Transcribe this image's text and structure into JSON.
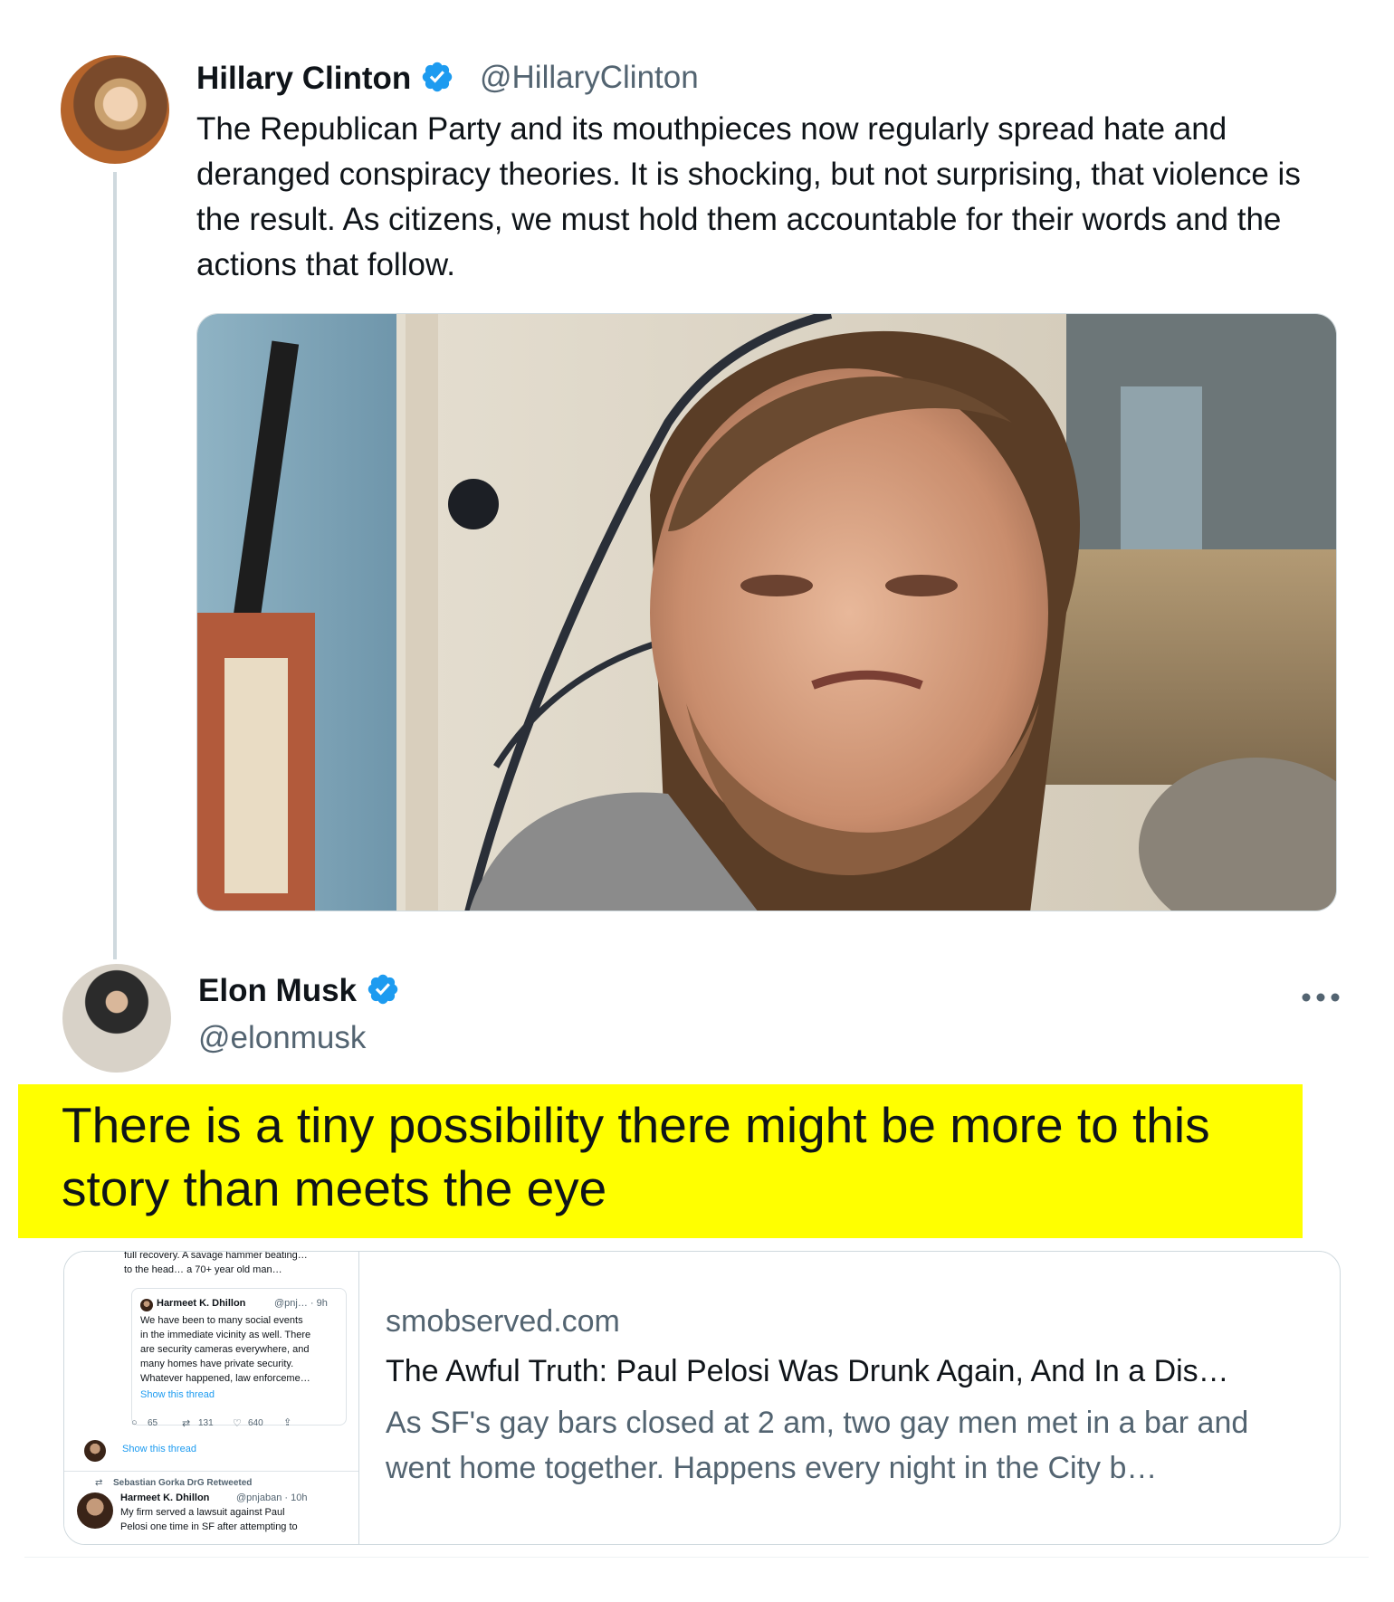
{
  "tweet1": {
    "name": "Hillary Clinton",
    "handle": "@HillaryClinton",
    "text": "The Republican Party and its mouthpieces now regularly spread hate and deranged conspiracy theories. It is shocking, but not surprising, that violence is the result. As citizens, we must hold them accountable for their words and the actions that follow.",
    "avatar_icon": "profile-photo",
    "verified_icon": "verified-badge-icon",
    "media": "photo-man-portrait"
  },
  "tweet2": {
    "name": "Elon Musk",
    "handle": "@elonmusk",
    "text": "There is a tiny possibility there might be more to this story than meets the eye",
    "more_icon": "ellipsis-icon",
    "highlight_color": "#ffff00",
    "card": {
      "domain": "smobserved.com",
      "title": "The Awful Truth: Paul Pelosi Was Drunk Again, And In a Dis…",
      "description": "As SF's gay bars closed at 2 am, two gay men met in a bar and went home together. Happens every night in the City b…",
      "thumb": {
        "top_text_1": "full recovery. A savage hammer beating…",
        "top_text_2": "to the head… a 70+ year old man…",
        "quote_name": "Harmeet K. Dhillon",
        "quote_meta": "@pnj… · 9h",
        "quote_text_1": "We have been to many social events",
        "quote_text_2": "in the immediate vicinity as well. There",
        "quote_text_3": "are security cameras everywhere, and",
        "quote_text_4": "many homes have private security.",
        "quote_text_5": "Whatever happened, law enforceme…",
        "show_thread_1": "Show this thread",
        "reply_count": "65",
        "retweet_count": "131",
        "like_count": "640",
        "show_thread_2": "Show this thread",
        "retweeted_by": "Sebastian Gorka DrG Retweeted",
        "tweet_name": "Harmeet K. Dhillon",
        "tweet_meta": "@pnjaban · 10h",
        "tweet_text_1": "My firm served a lawsuit against Paul",
        "tweet_text_2": "Pelosi one time in SF after attempting to"
      }
    }
  },
  "colors": {
    "link_blue": "#1d9bf0",
    "secondary_text": "#536471",
    "primary_text": "#0f1419"
  }
}
